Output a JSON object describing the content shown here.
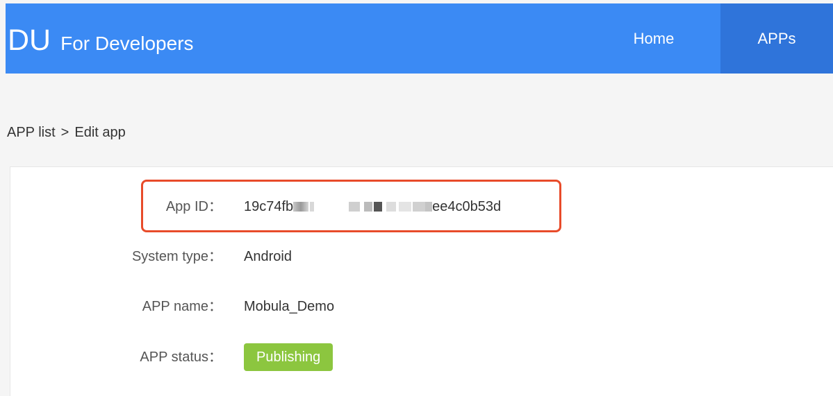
{
  "header": {
    "logo": "DU",
    "brand_text": "For Developers",
    "nav": {
      "home": "Home",
      "apps": "APPs"
    },
    "colors": {
      "bar": "#3b8af4",
      "active_tab": "#2f74da"
    }
  },
  "breadcrumb": {
    "parent": "APP list",
    "separator": ">",
    "current": "Edit app"
  },
  "details": {
    "app_id": {
      "label": "App ID：",
      "value_start": "19c74fb",
      "value_end": "ee4c0b53d"
    },
    "system_type": {
      "label": "System type：",
      "value": "Android"
    },
    "app_name": {
      "label": "APP name：",
      "value": "Mobula_Demo"
    },
    "app_status": {
      "label": "APP status：",
      "value": "Publishing",
      "color": "#8cc63f"
    },
    "highlight_color": "#e84b2a"
  }
}
